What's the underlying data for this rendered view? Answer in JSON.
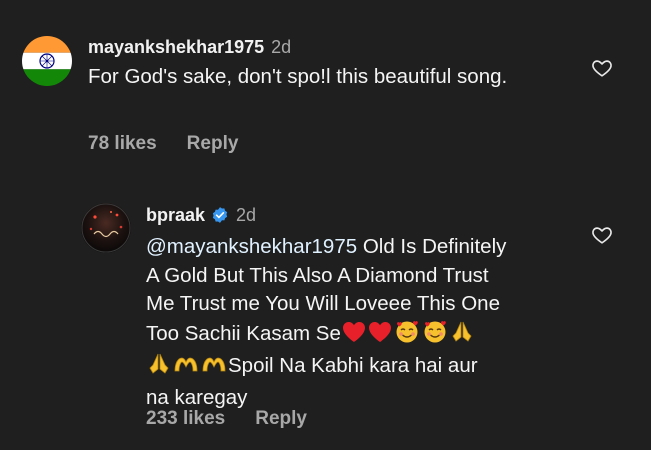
{
  "comments": [
    {
      "username": "mayankshekhar1975",
      "time": "2d",
      "text": "For God's sake, don't spo!l this beautiful song.",
      "likes": "78 likes",
      "reply_label": "Reply",
      "avatar_icon": "india-flag-icon"
    },
    {
      "username": "bpraak",
      "time": "2d",
      "verified": true,
      "mention": "@mayankshekhar1975",
      "text_line1": " Old Is Definitely",
      "text_line2": "A Gold But This Also A Diamond Trust",
      "text_line3": "Me Trust me You Will Loveee This One",
      "text_line4": "Too Sachii Kasam Se",
      "text_line5": "Spoil Na Kabhi kara hai aur",
      "text_line6": "na karegay",
      "likes": "233 likes",
      "reply_label": "Reply",
      "avatar_icon": "profile-photo-icon"
    }
  ],
  "colors": {
    "background": "#1f1f1f",
    "text": "#f2f2f2",
    "secondary": "#a8a8a8",
    "verified": "#3797f0",
    "heart_emoji": "#e8202a"
  }
}
